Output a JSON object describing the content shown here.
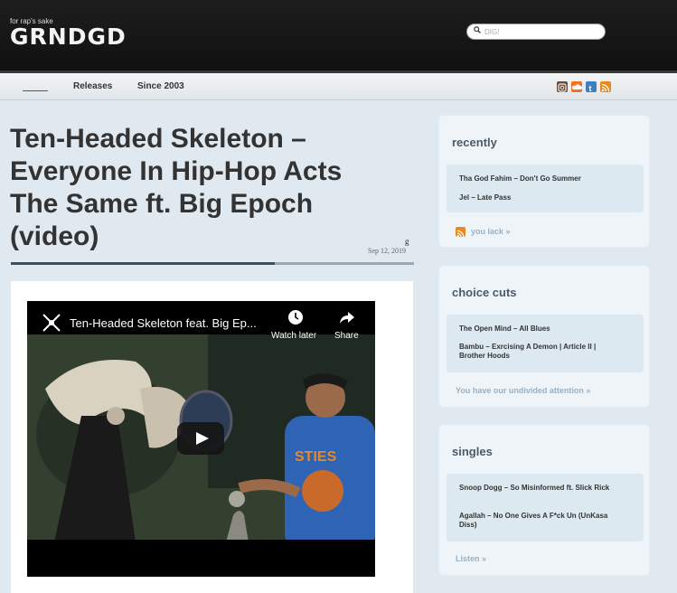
{
  "site": {
    "tagline": "for rap's sake",
    "logo": "GRNDGD"
  },
  "search": {
    "placeholder": "DIG!",
    "icon": "search-icon"
  },
  "nav": {
    "items": [
      "Releases",
      "Since 2003"
    ],
    "social_icons": [
      "instagram-icon",
      "soundcloud-icon",
      "tumblr-icon",
      "rss-icon"
    ]
  },
  "article": {
    "title": "Ten-Headed Skeleton – Everyone In Hip-Hop Acts The Same ft. Big Epoch (video)",
    "author": "g",
    "date": "Sep 12, 2019"
  },
  "video": {
    "title": "Ten-Headed Skeleton feat. Big Ep...",
    "watch_later": "Watch later",
    "share": "Share"
  },
  "sidebar": {
    "recently": {
      "title": "recently",
      "items": [
        "Tha God Fahim – Don't Go Summer",
        "Jel – Late Pass"
      ],
      "more": "you lack »"
    },
    "choice_cuts": {
      "title": "choice cuts",
      "items": [
        "The Open Mind – All Blues",
        "Bambu – Exrcising A Demon | Article II | Brother Hoods"
      ],
      "more": "You have our undivided attention »"
    },
    "singles": {
      "title": "singles",
      "items": [
        "Snoop Dogg – So Misinformed ft. Slick Rick",
        "Agallah – No One Gives A F*ck Un (UnKasa Diss)"
      ],
      "more": "Listen »"
    }
  },
  "colors": {
    "header": "#151515",
    "page_bg": "#dfe9ef",
    "sidebar_box": "#eef4f8",
    "sidebar_inner": "#dde9f1",
    "accent_orange": "#e8891f",
    "title_bar": "#3f4f5b"
  }
}
